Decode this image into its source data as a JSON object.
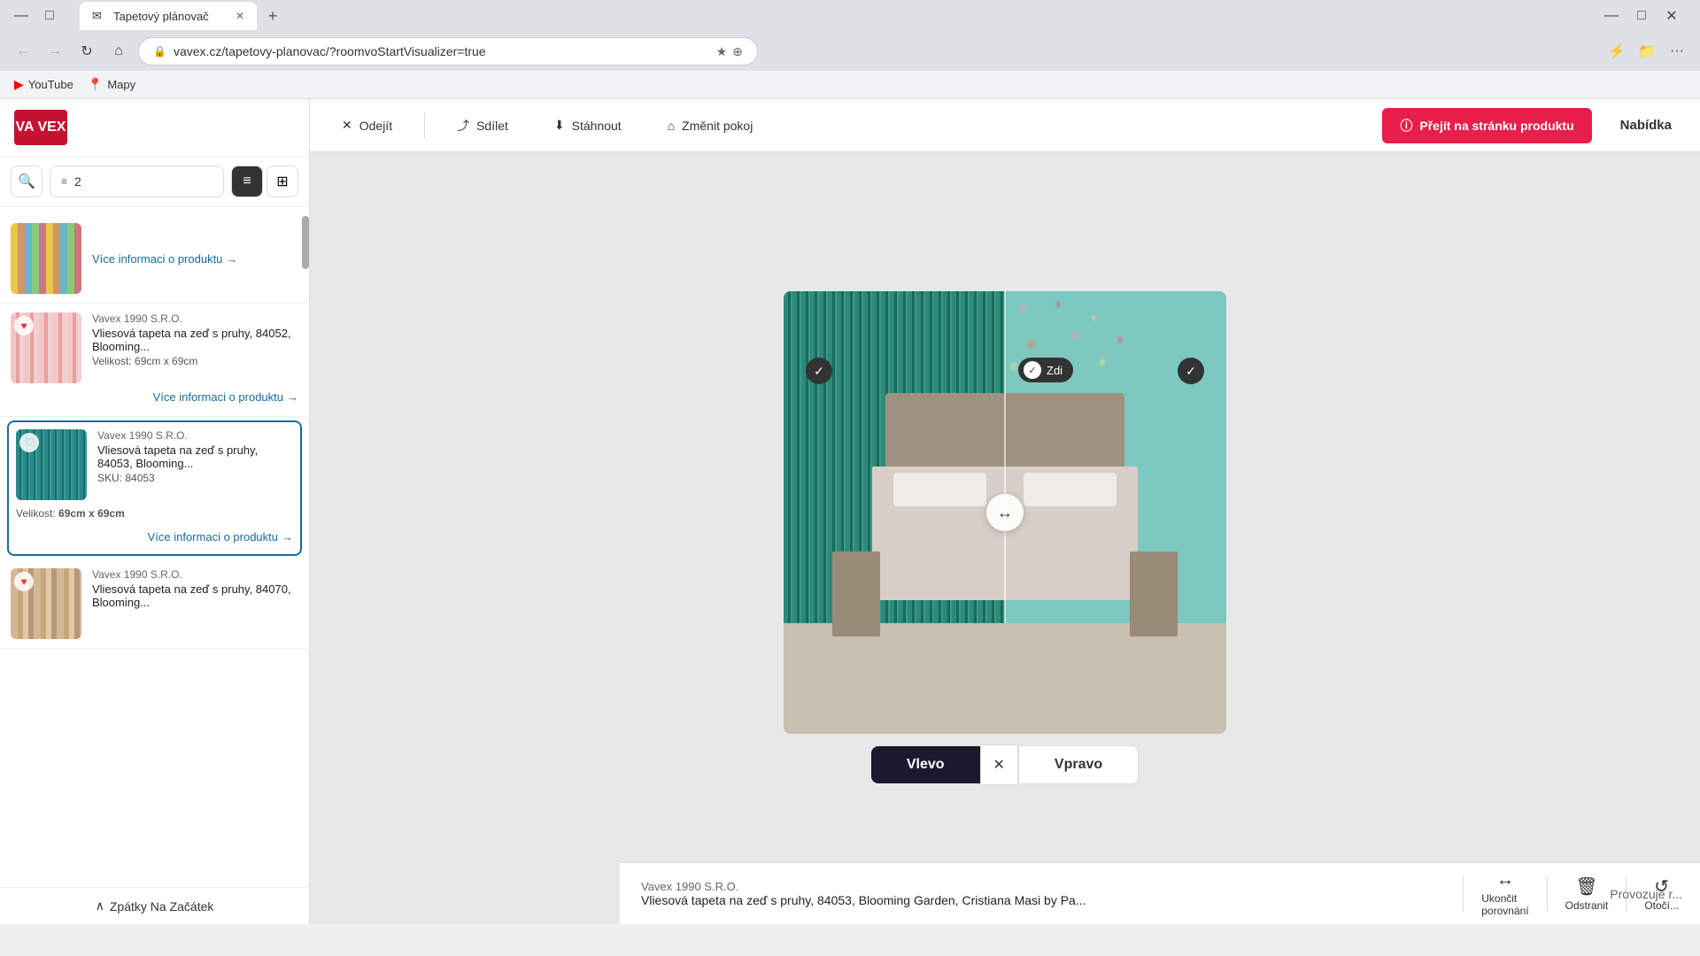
{
  "browser": {
    "tab_title": "Tapetový plánovač",
    "tab_favicon": "✉",
    "address_url": "vavex.cz/tapetovy-planovac/?roomvoStartVisualizer=true",
    "back_disabled": true,
    "forward_disabled": true
  },
  "bookmarks": [
    {
      "id": "youtube",
      "label": "YouTube",
      "icon": "▶"
    },
    {
      "id": "maps",
      "label": "Mapy",
      "icon": "📍"
    }
  ],
  "sidebar": {
    "logo_text": "VA\nVEX",
    "filter_count": "2",
    "list_view_label": "List",
    "grid_view_label": "Grid",
    "back_to_top": "Zpátky Na Začátek",
    "products": [
      {
        "id": "p0",
        "brand": "",
        "name": "Více informaci o produktu",
        "size": "",
        "sku": "",
        "thumb_class": "thumb-stripes-multicolor",
        "liked": false,
        "show_link": true,
        "selected": false
      },
      {
        "id": "p1",
        "brand": "Vavex 1990 S.R.O.",
        "name": "Vliesová tapeta na zeď s pruhy, 84052, Blooming...",
        "size": "Velikost: 69cm x 69cm",
        "sku": "",
        "thumb_class": "thumb-stripes-pink",
        "liked": true,
        "show_link": true,
        "selected": false
      },
      {
        "id": "p2",
        "brand": "Vavex 1990 S.R.O.",
        "name": "Vliesová tapeta na zeď s pruhy, 84053, Blooming...",
        "size": "Velikost: 69cm x 69cm",
        "sku": "SKU: 84053",
        "thumb_class": "thumb-stripes-teal",
        "liked": false,
        "show_link": true,
        "selected": true
      },
      {
        "id": "p3",
        "brand": "Vavex 1990 S.R.O.",
        "name": "Vliesová tapeta na zeď s pruhy, 84070, Blooming...",
        "size": "",
        "sku": "",
        "thumb_class": "thumb-stripes-warm",
        "liked": true,
        "show_link": false,
        "selected": false
      }
    ]
  },
  "toolbar": {
    "exit_label": "Odejít",
    "share_label": "Sdílet",
    "download_label": "Stáhnout",
    "change_room_label": "Změnit pokoj",
    "go_to_product_label": "Přejít na stránku produktu",
    "offer_label": "Nabídka"
  },
  "visualizer": {
    "left_btn_label": "Vlevo",
    "right_btn_label": "Vpravo",
    "wall_label": "Zdi",
    "drag_icon": "↔",
    "provozuje_text": "Provozuje r..."
  },
  "bottom_bar": {
    "brand": "Vavex 1990 S.R.O.",
    "product_name": "Vliesová tapeta na zeď s pruhy, 84053, Blooming Garden, Cristiana Masi by Pa...",
    "end_comparison_label": "Ukončit\nporovnání",
    "remove_label": "Odstranit",
    "rotate_label": "Otočí..."
  }
}
